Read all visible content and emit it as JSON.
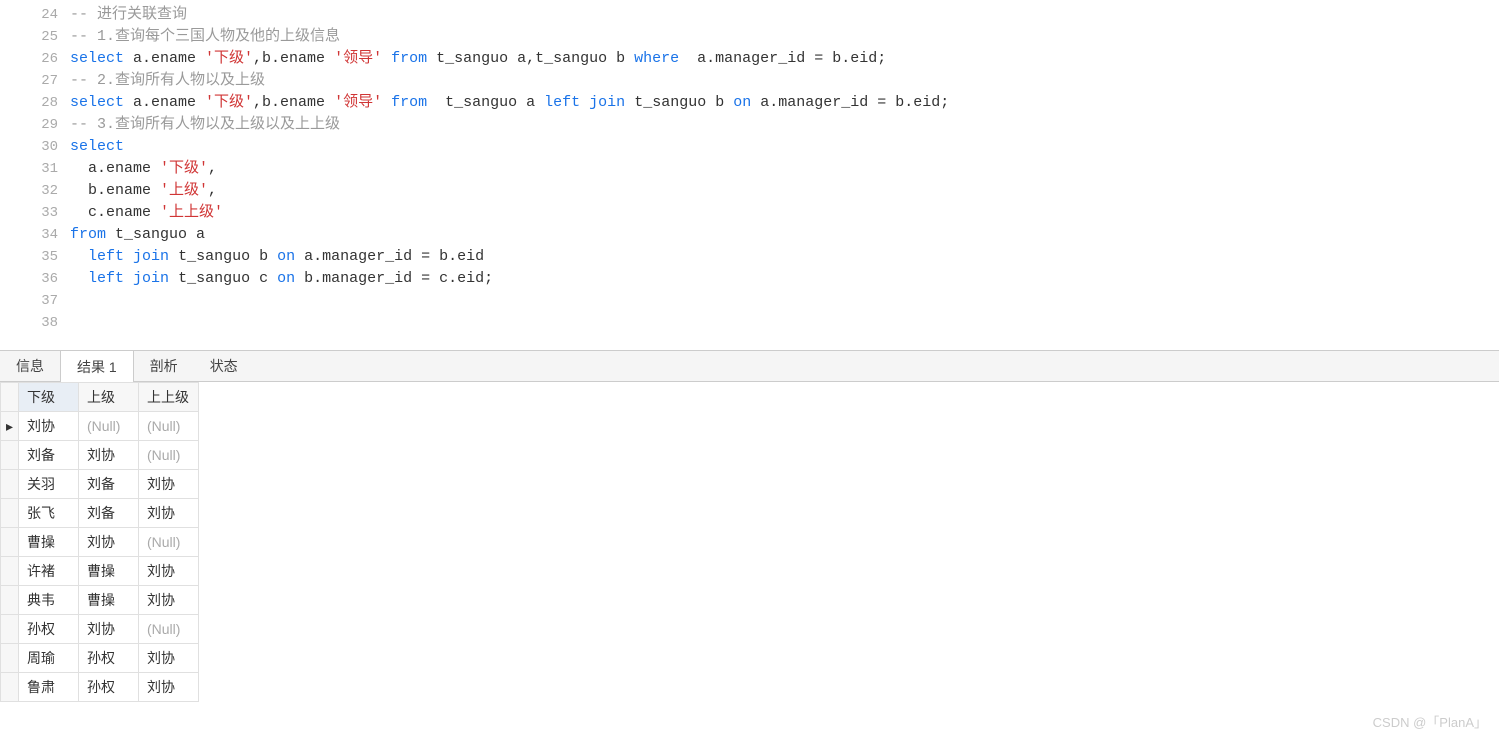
{
  "editor": {
    "lines": [
      {
        "num": 24,
        "tokens": [
          {
            "t": "-- ",
            "cls": "c-comment"
          },
          {
            "t": "进行关联查询",
            "cls": "c-comment"
          }
        ]
      },
      {
        "num": 25,
        "tokens": [
          {
            "t": "-- 1.",
            "cls": "c-comment"
          },
          {
            "t": "查询每个三国人物及他的上级信息",
            "cls": "c-comment"
          }
        ]
      },
      {
        "num": 26,
        "tokens": [
          {
            "t": "select",
            "cls": "c-keyword"
          },
          {
            "t": " a.ename ",
            "cls": "c-default"
          },
          {
            "t": "'下级'",
            "cls": "c-string"
          },
          {
            "t": ",b.ename ",
            "cls": "c-default"
          },
          {
            "t": "'领导'",
            "cls": "c-string"
          },
          {
            "t": " ",
            "cls": "c-default"
          },
          {
            "t": "from",
            "cls": "c-keyword"
          },
          {
            "t": " t_sanguo a,t_sanguo b ",
            "cls": "c-default"
          },
          {
            "t": "where",
            "cls": "c-keyword"
          },
          {
            "t": "  a.manager_id = b.eid;",
            "cls": "c-default"
          }
        ]
      },
      {
        "num": 27,
        "tokens": [
          {
            "t": "-- 2.",
            "cls": "c-comment"
          },
          {
            "t": "查询所有人物以及上级",
            "cls": "c-comment"
          }
        ]
      },
      {
        "num": 28,
        "tokens": [
          {
            "t": "select",
            "cls": "c-keyword"
          },
          {
            "t": " a.ename ",
            "cls": "c-default"
          },
          {
            "t": "'下级'",
            "cls": "c-string"
          },
          {
            "t": ",b.ename ",
            "cls": "c-default"
          },
          {
            "t": "'领导'",
            "cls": "c-string"
          },
          {
            "t": " ",
            "cls": "c-default"
          },
          {
            "t": "from",
            "cls": "c-keyword"
          },
          {
            "t": "  t_sanguo a ",
            "cls": "c-default"
          },
          {
            "t": "left",
            "cls": "c-keyword"
          },
          {
            "t": " ",
            "cls": "c-default"
          },
          {
            "t": "join",
            "cls": "c-keyword"
          },
          {
            "t": " t_sanguo b ",
            "cls": "c-default"
          },
          {
            "t": "on",
            "cls": "c-keyword"
          },
          {
            "t": " a.manager_id = b.eid;",
            "cls": "c-default"
          }
        ]
      },
      {
        "num": 29,
        "tokens": [
          {
            "t": "-- 3.",
            "cls": "c-comment"
          },
          {
            "t": "查询所有人物以及上级以及上上级",
            "cls": "c-comment"
          }
        ]
      },
      {
        "num": 30,
        "tokens": [
          {
            "t": "select",
            "cls": "c-keyword"
          }
        ]
      },
      {
        "num": 31,
        "tokens": [
          {
            "t": "  a.ename ",
            "cls": "c-default"
          },
          {
            "t": "'下级'",
            "cls": "c-string"
          },
          {
            "t": ",",
            "cls": "c-default"
          }
        ]
      },
      {
        "num": 32,
        "tokens": [
          {
            "t": "  b.ename ",
            "cls": "c-default"
          },
          {
            "t": "'上级'",
            "cls": "c-string"
          },
          {
            "t": ",",
            "cls": "c-default"
          }
        ]
      },
      {
        "num": 33,
        "tokens": [
          {
            "t": "  c.ename ",
            "cls": "c-default"
          },
          {
            "t": "'上上级'",
            "cls": "c-string"
          }
        ]
      },
      {
        "num": 34,
        "tokens": [
          {
            "t": "from",
            "cls": "c-keyword"
          },
          {
            "t": " t_sanguo a",
            "cls": "c-default"
          }
        ]
      },
      {
        "num": 35,
        "tokens": [
          {
            "t": "  ",
            "cls": "c-default"
          },
          {
            "t": "left",
            "cls": "c-keyword"
          },
          {
            "t": " ",
            "cls": "c-default"
          },
          {
            "t": "join",
            "cls": "c-keyword"
          },
          {
            "t": " t_sanguo b ",
            "cls": "c-default"
          },
          {
            "t": "on",
            "cls": "c-keyword"
          },
          {
            "t": " a.manager_id = b.eid",
            "cls": "c-default"
          }
        ]
      },
      {
        "num": 36,
        "tokens": [
          {
            "t": "  ",
            "cls": "c-default"
          },
          {
            "t": "left",
            "cls": "c-keyword"
          },
          {
            "t": " ",
            "cls": "c-default"
          },
          {
            "t": "join",
            "cls": "c-keyword"
          },
          {
            "t": " t_sanguo c ",
            "cls": "c-default"
          },
          {
            "t": "on",
            "cls": "c-keyword"
          },
          {
            "t": " b.manager_id = c.eid;",
            "cls": "c-default"
          }
        ]
      },
      {
        "num": 37,
        "tokens": [
          {
            "t": "",
            "cls": "c-default"
          }
        ]
      },
      {
        "num": 38,
        "tokens": [
          {
            "t": "",
            "cls": "c-default"
          }
        ]
      }
    ]
  },
  "tabs": {
    "info": "信息",
    "result": "结果 1",
    "profile": "剖析",
    "state": "状态",
    "active": "结果 1"
  },
  "results": {
    "columns": [
      "下级",
      "上级",
      "上上级"
    ],
    "sortedCol": 0,
    "rows": [
      {
        "indicator": "▸",
        "cells": [
          "刘协",
          null,
          null
        ]
      },
      {
        "indicator": "",
        "cells": [
          "刘备",
          "刘协",
          null
        ]
      },
      {
        "indicator": "",
        "cells": [
          "关羽",
          "刘备",
          "刘协"
        ]
      },
      {
        "indicator": "",
        "cells": [
          "张飞",
          "刘备",
          "刘协"
        ]
      },
      {
        "indicator": "",
        "cells": [
          "曹操",
          "刘协",
          null
        ]
      },
      {
        "indicator": "",
        "cells": [
          "许褚",
          "曹操",
          "刘协"
        ]
      },
      {
        "indicator": "",
        "cells": [
          "典韦",
          "曹操",
          "刘协"
        ]
      },
      {
        "indicator": "",
        "cells": [
          "孙权",
          "刘协",
          null
        ]
      },
      {
        "indicator": "",
        "cells": [
          "周瑜",
          "孙权",
          "刘协"
        ]
      },
      {
        "indicator": "",
        "cells": [
          "鲁肃",
          "孙权",
          "刘协"
        ]
      }
    ],
    "nullText": "(Null)"
  },
  "watermark": "CSDN @「PlanA」"
}
